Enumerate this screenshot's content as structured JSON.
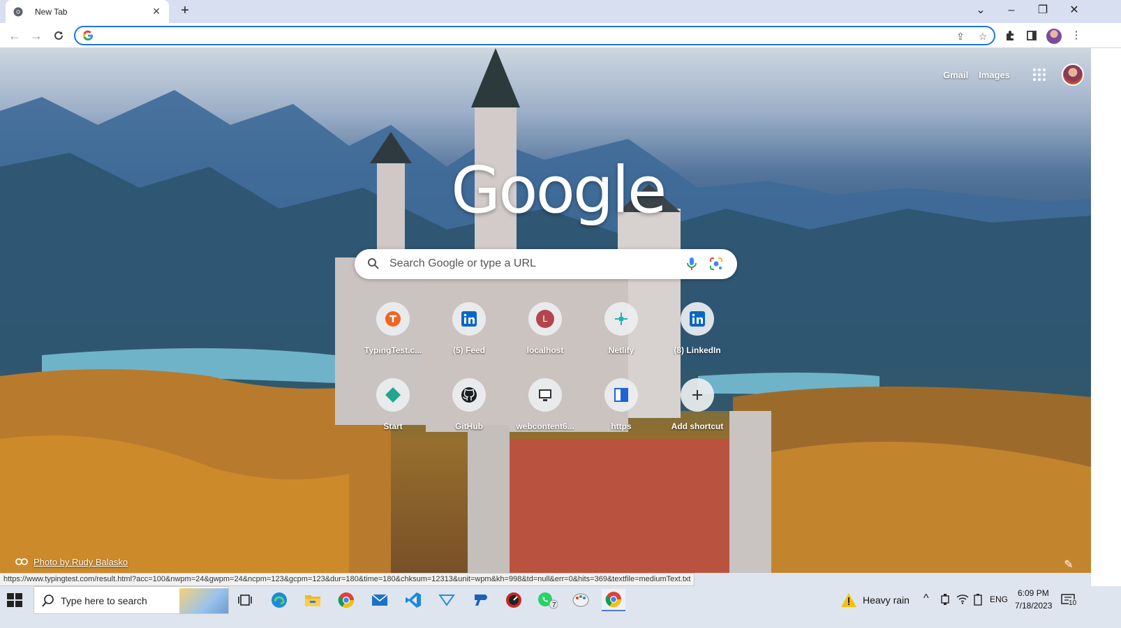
{
  "browser": {
    "tab_title": "New Tab",
    "address_value": "",
    "address_placeholder": ""
  },
  "toplinks": {
    "gmail": "Gmail",
    "images": "Images"
  },
  "logo_text": "Google",
  "search": {
    "placeholder": "Search Google or type a URL"
  },
  "shortcuts": [
    {
      "label": "TypingTest.c...",
      "icon": "typingtest-icon"
    },
    {
      "label": "(5) Feed",
      "icon": "linkedin-icon"
    },
    {
      "label": "localhost",
      "icon": "letter-l-icon",
      "letter": "L"
    },
    {
      "label": "Netlify",
      "icon": "netlify-icon"
    },
    {
      "label": "(8) LinkedIn",
      "icon": "linkedin-icon"
    },
    {
      "label": "Start",
      "icon": "diamond-icon"
    },
    {
      "label": "GitHub",
      "icon": "github-icon"
    },
    {
      "label": "webcontent6...",
      "icon": "webcontent-icon"
    },
    {
      "label": "https",
      "icon": "https-icon"
    },
    {
      "label": "Add shortcut",
      "icon": "plus-icon"
    }
  ],
  "attribution": "Photo by Rudy Balasko",
  "status_url": "https://www.typingtest.com/result.html?acc=100&nwpm=24&gwpm=24&ncpm=123&gcpm=123&dur=180&time=180&chksum=12313&unit=wpm&kh=998&td=null&err=0&hits=369&textfile=mediumText.txt",
  "taskbar": {
    "search_placeholder": "Type here to search",
    "weather": "Heavy rain",
    "language": "ENG",
    "time": "6:09 PM",
    "date": "7/18/2023",
    "whatsapp_badge": "7",
    "notifications": "10"
  },
  "colors": {
    "accent": "#1a73e8",
    "tab_strip": "#d7dff0",
    "taskbar": "#dfe5ef"
  }
}
